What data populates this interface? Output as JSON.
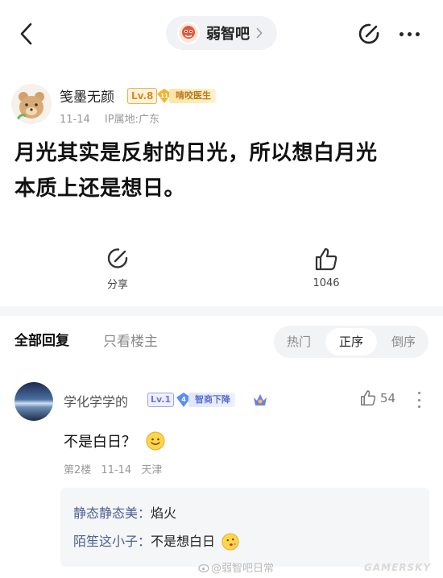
{
  "topbar": {
    "forum_name": "弱智吧"
  },
  "post": {
    "author": {
      "name": "笺墨无颜",
      "level": "Lv.8",
      "title_level": "11",
      "title": "啃咬医生"
    },
    "meta": {
      "date": "11-14",
      "ip": "IP属地:广东"
    },
    "body_line1": "月光其实是反射的日光，所以想白月光",
    "body_line2": "本质上还是想日。",
    "actions": {
      "share_label": "分享",
      "like_count": "1046"
    }
  },
  "reply_tabs": {
    "all": "全部回复",
    "op_only": "只看楼主",
    "sort": {
      "hot": "热门",
      "asc": "正序",
      "desc": "倒序",
      "selected": "正序"
    }
  },
  "comment": {
    "user": "学化学学的",
    "level": "Lv.1",
    "title_level": "4",
    "title": "智商下降",
    "like_count": "54",
    "text": "不是白日？",
    "floor": "第2楼",
    "date": "11-14",
    "location": "天津",
    "sub_replies": [
      {
        "user": "静态静态美",
        "text": "焰火"
      },
      {
        "user": "陌笙这小子",
        "text": "不是想白日"
      }
    ]
  },
  "watermark": {
    "weibo": "@弱智吧日常",
    "site": "GAMERSKY"
  },
  "colors": {
    "accent_gold": "#d38d11",
    "accent_blue": "#5a6fd3",
    "sub_user": "#4d6191"
  }
}
